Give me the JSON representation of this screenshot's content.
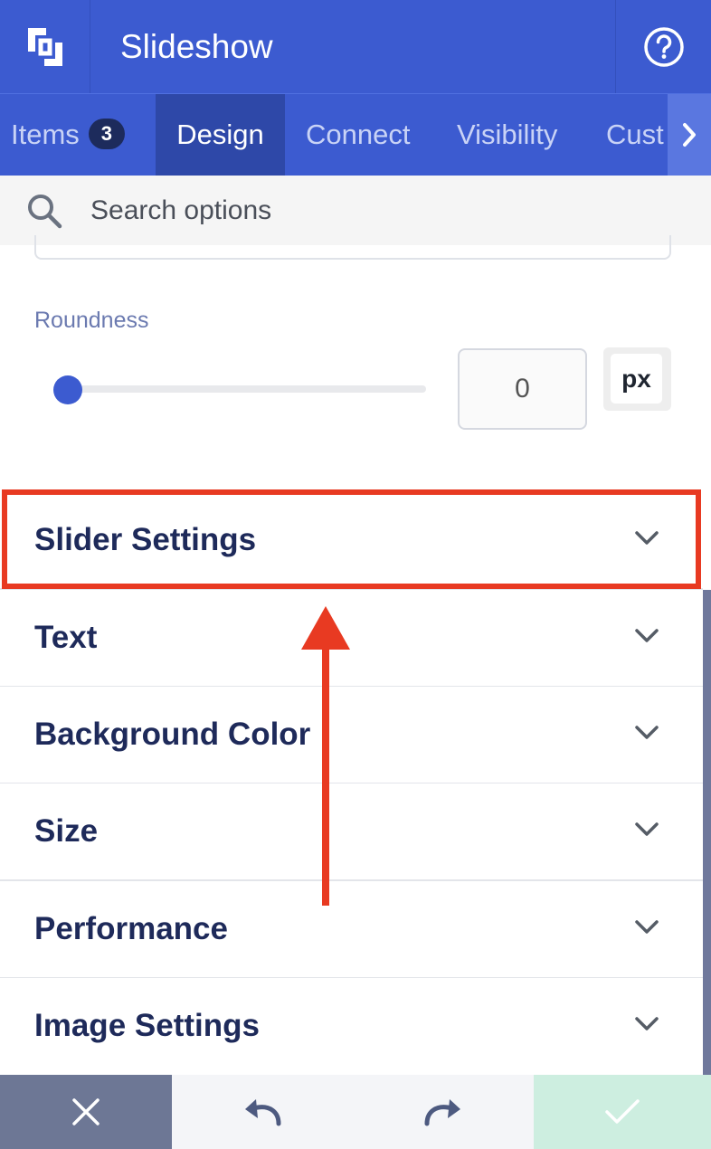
{
  "app": {
    "title": "Slideshow",
    "logo_icon": "brackets-logo-icon",
    "help_icon": "question-circle-icon"
  },
  "tabs": [
    {
      "label": "Items",
      "badge": "3",
      "active": false
    },
    {
      "label": "Design",
      "active": true
    },
    {
      "label": "Connect",
      "active": false
    },
    {
      "label": "Visibility",
      "active": false
    },
    {
      "label": "Cust",
      "active": false
    }
  ],
  "search": {
    "placeholder": "Search options",
    "value": ""
  },
  "roundness": {
    "label": "Roundness",
    "value": "0",
    "slider_fraction": 0,
    "unit": "px"
  },
  "sections": [
    {
      "label": "Slider Settings",
      "highlighted": true
    },
    {
      "label": "Text"
    },
    {
      "label": "Background Color"
    },
    {
      "label": "Size"
    },
    {
      "label": "Performance"
    },
    {
      "label": "Image Settings"
    }
  ],
  "bottom_bar": {
    "cancel_icon": "close-icon",
    "undo_icon": "undo-icon",
    "redo_icon": "redo-icon",
    "confirm_icon": "check-icon"
  },
  "colors": {
    "primary": "#3c5bd0",
    "active_tab": "#2e48a8",
    "section_text": "#1e2a5a",
    "highlight": "#e83a22",
    "confirm_bg": "#cdeee0"
  }
}
